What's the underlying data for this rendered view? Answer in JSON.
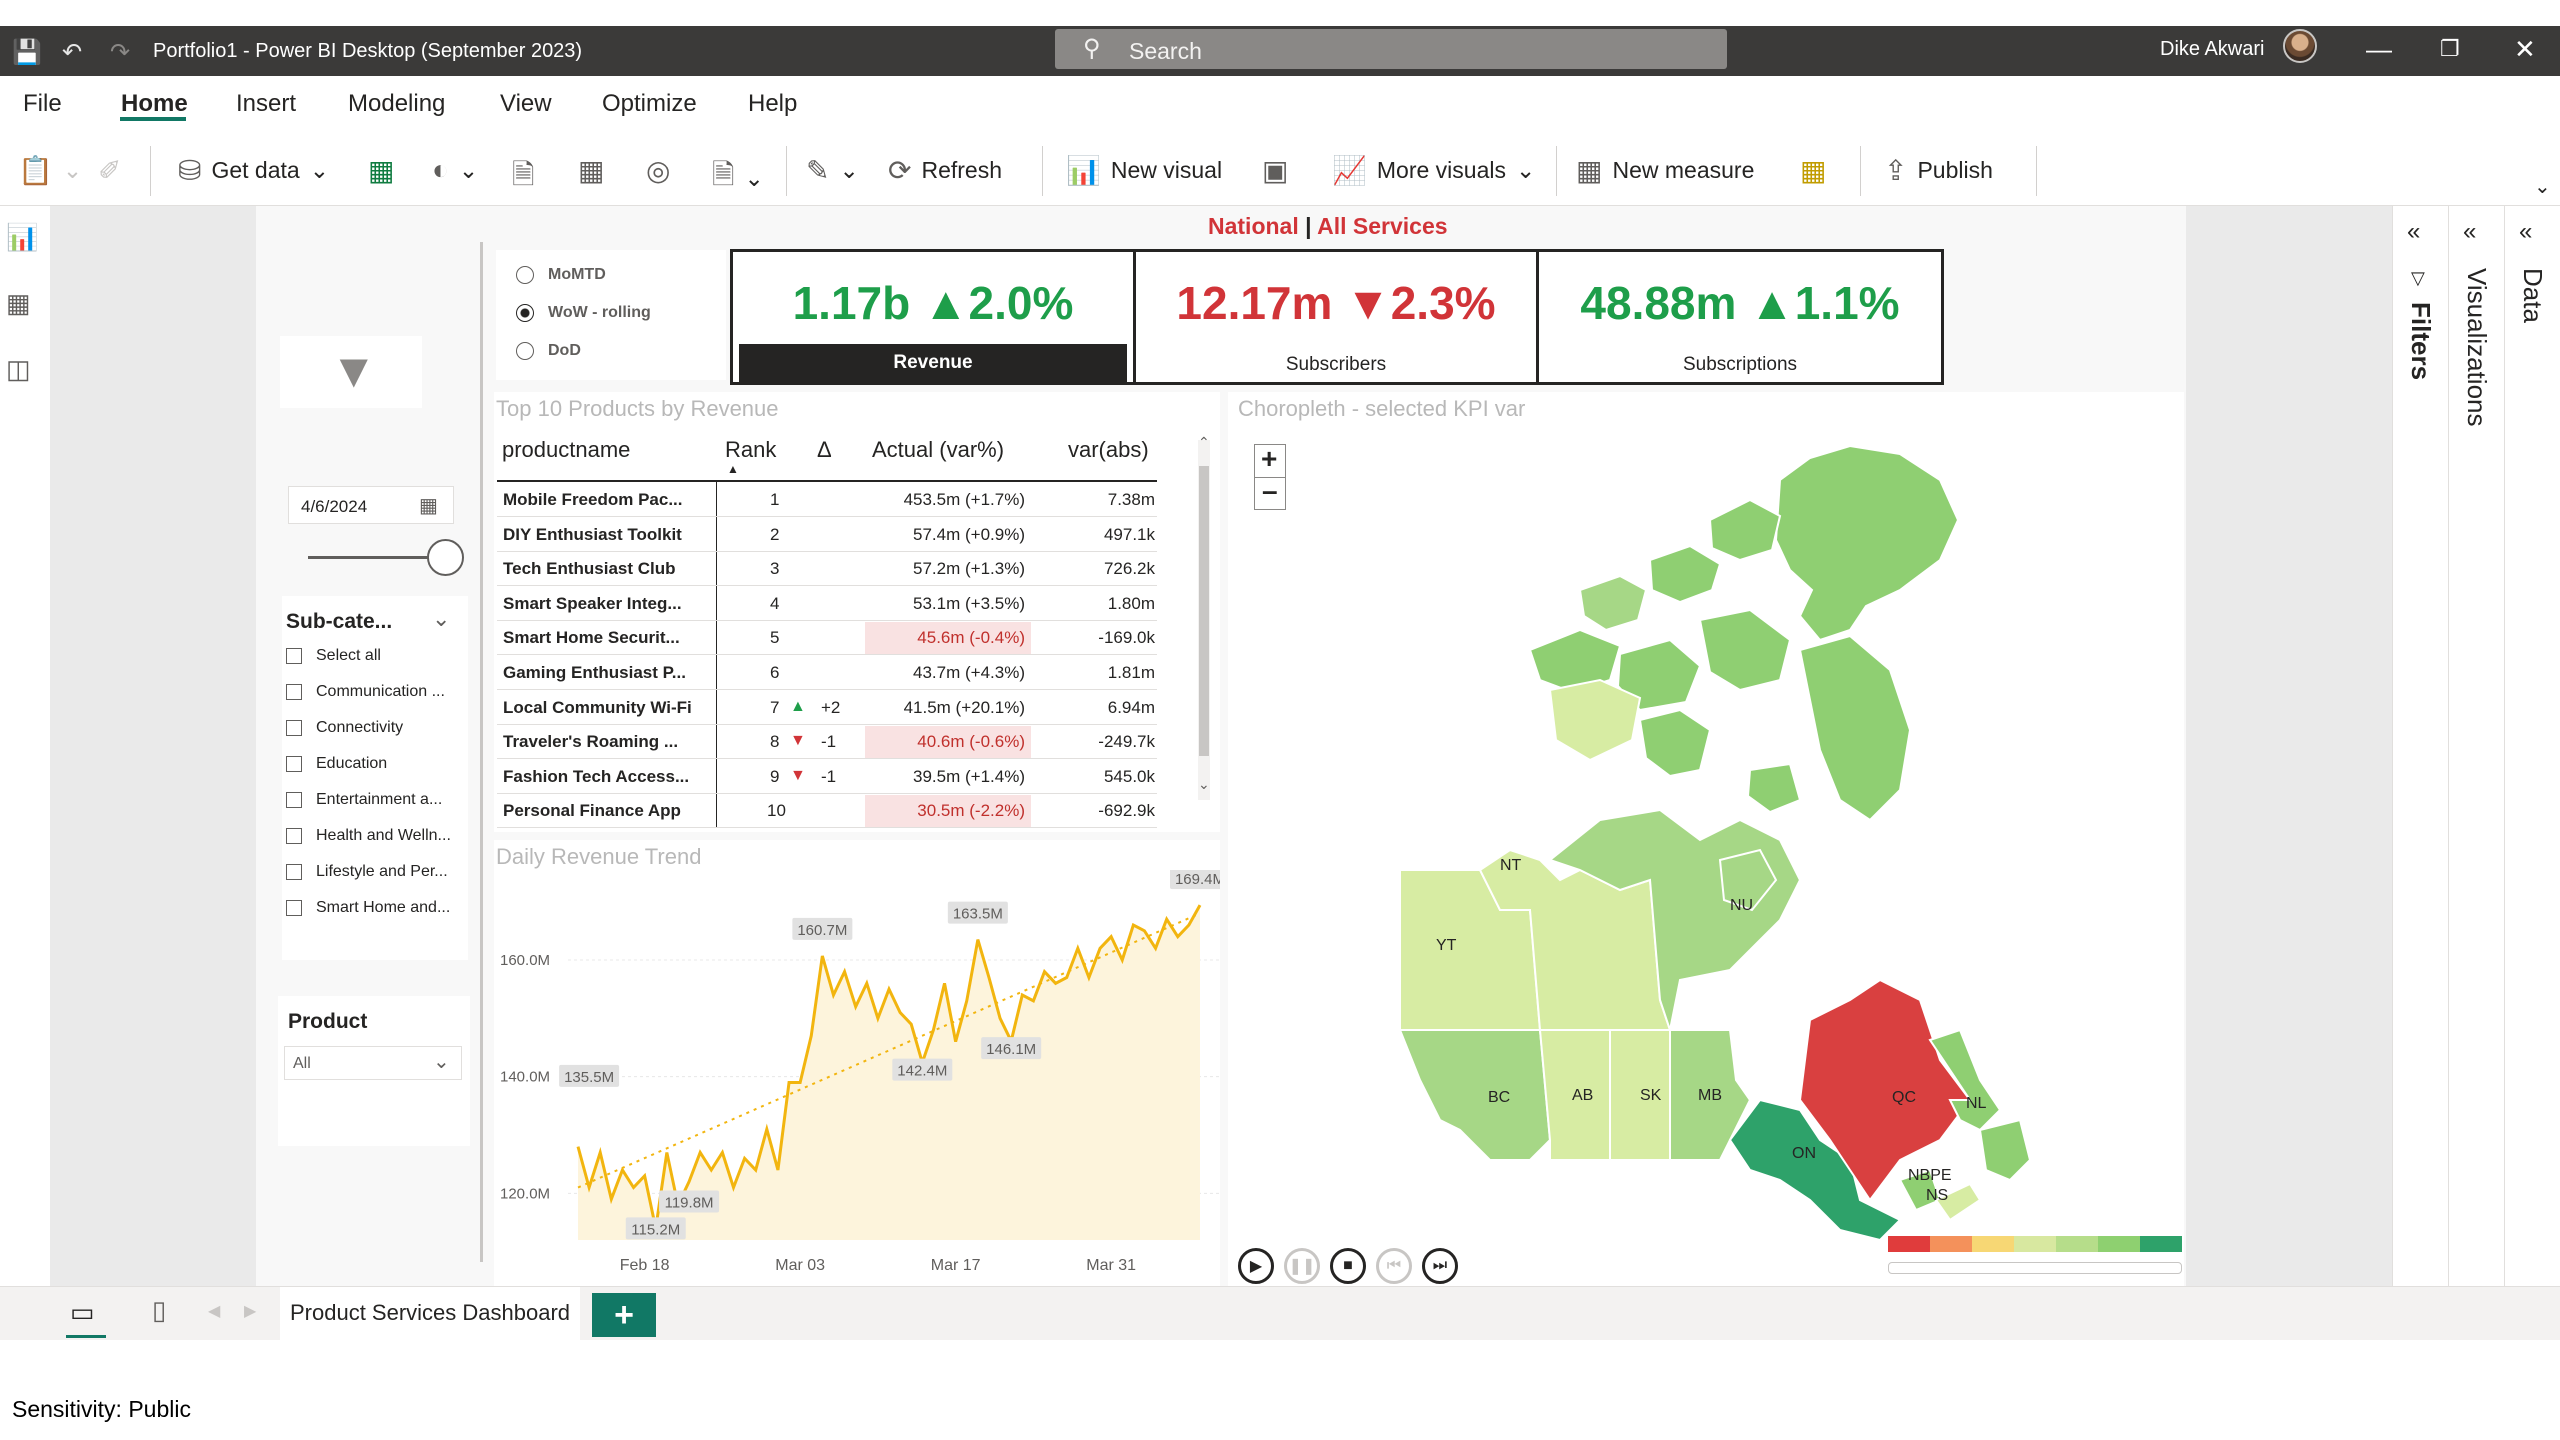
{
  "titlebar": {
    "title": "Portfolio1 - Power BI Desktop (September 2023)",
    "search_placeholder": "Search",
    "user": "Dike Akwari"
  },
  "menu": [
    "File",
    "Home",
    "Insert",
    "Modeling",
    "View",
    "Optimize",
    "Help"
  ],
  "ribbon": {
    "get_data": "Get data",
    "refresh": "Refresh",
    "new_visual": "New visual",
    "more_visuals": "More visuals",
    "new_measure": "New measure",
    "publish": "Publish"
  },
  "header_title": {
    "part1": "National",
    "sep": " | ",
    "part2": "All Services"
  },
  "period_options": [
    {
      "label": "MoMTD",
      "selected": false
    },
    {
      "label": "WoW - rolling",
      "selected": true
    },
    {
      "label": "DoD",
      "selected": false
    }
  ],
  "kpis": [
    {
      "value": "1.17b ▲2.0%",
      "label": "Revenue",
      "color": "#1e9e4a",
      "selected": true
    },
    {
      "value": "12.17m ▼2.3%",
      "label": "Subscribers",
      "color": "#d13438",
      "selected": false
    },
    {
      "value": "48.88m ▲1.1%",
      "label": "Subscriptions",
      "color": "#1e9e4a",
      "selected": false
    }
  ],
  "slicers": {
    "date": "4/6/2024",
    "subcategory_title": "Sub-cate...",
    "subcategories": [
      "Select all",
      "Communication ...",
      "Connectivity",
      "Education",
      "Entertainment a...",
      "Health and Welln...",
      "Lifestyle and Per...",
      "Smart Home and..."
    ],
    "product_title": "Product",
    "product_value": "All"
  },
  "top10": {
    "title": "Top 10 Products by Revenue",
    "columns": [
      "productname",
      "Rank",
      "Δ",
      "Actual (var%)",
      "var(abs)"
    ],
    "rows": [
      {
        "name": "Mobile Freedom Pac...",
        "rank": "1",
        "delta": "",
        "dir": "",
        "actual": "453.5m (+1.7%)",
        "abs": "7.38m",
        "neg": false
      },
      {
        "name": "DIY Enthusiast Toolkit",
        "rank": "2",
        "delta": "",
        "dir": "",
        "actual": "57.4m (+0.9%)",
        "abs": "497.1k",
        "neg": false
      },
      {
        "name": "Tech Enthusiast Club",
        "rank": "3",
        "delta": "",
        "dir": "",
        "actual": "57.2m (+1.3%)",
        "abs": "726.2k",
        "neg": false
      },
      {
        "name": "Smart Speaker Integ...",
        "rank": "4",
        "delta": "",
        "dir": "",
        "actual": "53.1m (+3.5%)",
        "abs": "1.80m",
        "neg": false
      },
      {
        "name": "Smart Home Securit...",
        "rank": "5",
        "delta": "",
        "dir": "",
        "actual": "45.6m (-0.4%)",
        "abs": "-169.0k",
        "neg": true
      },
      {
        "name": "Gaming Enthusiast P...",
        "rank": "6",
        "delta": "",
        "dir": "",
        "actual": "43.7m (+4.3%)",
        "abs": "1.81m",
        "neg": false
      },
      {
        "name": "Local Community Wi-Fi",
        "rank": "7",
        "delta": "+2",
        "dir": "up",
        "actual": "41.5m (+20.1%)",
        "abs": "6.94m",
        "neg": false
      },
      {
        "name": "Traveler's Roaming ...",
        "rank": "8",
        "delta": "-1",
        "dir": "down",
        "actual": "40.6m (-0.6%)",
        "abs": "-249.7k",
        "neg": true
      },
      {
        "name": "Fashion Tech Access...",
        "rank": "9",
        "delta": "-1",
        "dir": "down",
        "actual": "39.5m (+1.4%)",
        "abs": "545.0k",
        "neg": false
      },
      {
        "name": "Personal Finance App",
        "rank": "10",
        "delta": "",
        "dir": "",
        "actual": "30.5m (-2.2%)",
        "abs": "-692.9k",
        "neg": true
      }
    ]
  },
  "trend": {
    "title": "Daily Revenue Trend",
    "chart_data": {
      "type": "line",
      "yticks": [
        "160.0M",
        "140.0M",
        "120.0M"
      ],
      "ylim": [
        112,
        172
      ],
      "xticks": [
        "Feb 18",
        "Mar 03",
        "Mar 17",
        "Mar 31"
      ],
      "values": [
        128,
        121,
        127,
        119,
        124,
        121,
        123,
        114,
        127,
        118,
        122,
        127,
        124,
        127,
        121,
        126,
        124,
        131,
        124,
        139,
        139,
        147,
        160.7,
        154,
        158,
        152,
        156,
        150,
        155,
        151,
        149,
        142.4,
        148,
        156,
        146,
        153,
        163.5,
        157,
        150,
        146.1,
        154,
        153,
        158,
        156,
        157,
        162,
        157,
        162,
        164,
        160,
        166,
        165,
        162,
        167,
        164,
        166,
        169.4
      ],
      "annotations": [
        "160.7M",
        "163.5M",
        "169.4M",
        "135.5M",
        "146.1M",
        "142.4M",
        "115.2M",
        "119.8M"
      ]
    }
  },
  "choropleth": {
    "title": "Choropleth - selected KPI var",
    "provinces": [
      "NT",
      "NU",
      "YT",
      "BC",
      "AB",
      "SK",
      "MB",
      "ON",
      "QC",
      "NL",
      "NBPE",
      "NS"
    ],
    "legend_colors": [
      "#e03c3c",
      "#f4915b",
      "#f7d774",
      "#d8e8a0",
      "#b6dd8a",
      "#8ed070",
      "#2ea26a"
    ]
  },
  "right_panes": {
    "filters": "Filters",
    "visualizations": "Visualizations",
    "data": "Data"
  },
  "status": {
    "page_tab": "Product Services Dashboard"
  },
  "footer": {
    "sensitivity": "Sensitivity: Public"
  }
}
